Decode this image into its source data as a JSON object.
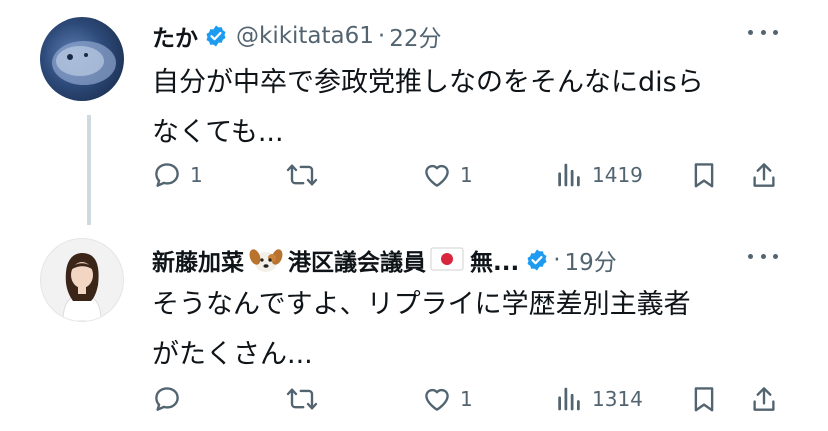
{
  "tweets": [
    {
      "name": "たか",
      "handle": "@kikitata61",
      "dot": "·",
      "time": "22分",
      "text_line1": "自分が中卒で参政党推しなのをそんなにdisら",
      "text_line2": "なくても...",
      "replies": "1",
      "retweets": "",
      "likes": "1",
      "views": "1419"
    },
    {
      "name_part1": "新藤加菜",
      "name_part2": "港区議会議員",
      "name_part3": "無...",
      "dot": "·",
      "time": "19分",
      "text_line1": "そうなんですよ、リプライに学歴差別主義者",
      "text_line2": "がたくさん...",
      "replies": "",
      "retweets": "",
      "likes": "1",
      "views": "1314"
    }
  ],
  "colors": {
    "text": "#0f1419",
    "secondary": "#536471",
    "verified": "#1d9bf0",
    "thread_line": "#cfd9de"
  },
  "icons": [
    "verified-badge-icon",
    "more-icon",
    "reply-icon",
    "retweet-icon",
    "like-icon",
    "views-icon",
    "bookmark-icon",
    "share-icon",
    "dog-emoji-icon",
    "japan-flag-emoji-icon"
  ]
}
